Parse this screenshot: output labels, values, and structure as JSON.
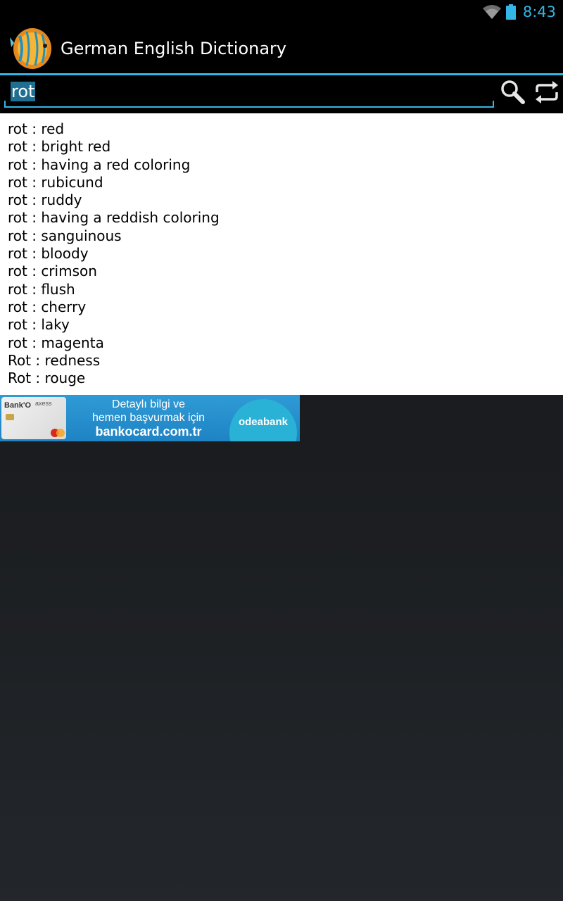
{
  "status_bar": {
    "time": "8:43",
    "icons": [
      "wifi-icon",
      "battery-icon"
    ],
    "accent_color": "#33b5e5"
  },
  "action_bar": {
    "app_icon": "discus-fish-icon",
    "title": "German English Dictionary"
  },
  "search": {
    "value": "rot",
    "buttons": [
      "search-icon",
      "swap-direction-icon"
    ]
  },
  "results": [
    "rot : red",
    "rot : bright red",
    "rot : having a red coloring",
    "rot : rubicund",
    "rot : ruddy",
    "rot : having a reddish coloring",
    "rot : sanguinous",
    "rot : bloody",
    "rot : crimson",
    "rot : flush",
    "rot : cherry",
    "rot : laky",
    "rot : magenta",
    "Rot : redness",
    "Rot : rouge"
  ],
  "ad": {
    "card_brand": "Bank'O",
    "card_brand2": "axess",
    "line1": "Detaylı bilgi ve",
    "line2": "hemen başvurmak için",
    "line3": "bankocard.com.tr",
    "logo_text": "odeabank"
  }
}
